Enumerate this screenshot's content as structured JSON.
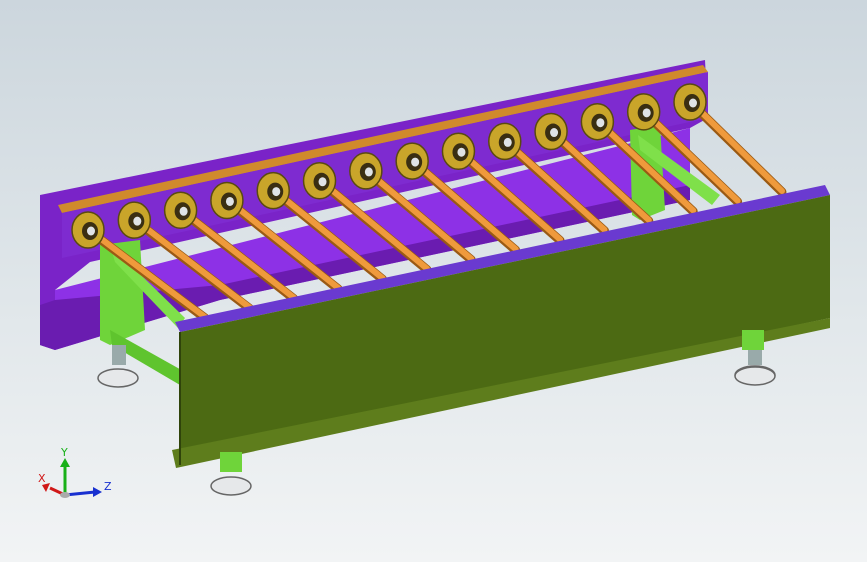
{
  "view": {
    "background_top": "#ccd6dd",
    "background_bottom": "#f2f4f5"
  },
  "model": {
    "roller_count": 14,
    "colors": {
      "back_rail": "#7a23c8",
      "back_rail_top": "#d08a2c",
      "front_rail": "#4c6a13",
      "front_rail_top": "#6a3ad0",
      "frame": "#6fd43a",
      "roller": "#ef9a3c",
      "bearing": "#c9a52a",
      "foot": "#e6e8ea"
    }
  },
  "triad": {
    "x_label": "X",
    "y_label": "Y",
    "z_label": "Z",
    "x_color": "#d01818",
    "y_color": "#18b018",
    "z_color": "#1830d0"
  }
}
